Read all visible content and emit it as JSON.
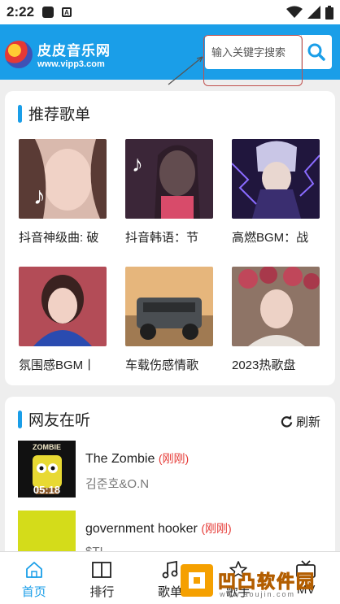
{
  "status_bar": {
    "time": "2:22"
  },
  "header": {
    "logo_name": "皮皮音乐网",
    "logo_url": "www.vipp3.com",
    "search_placeholder": "输入关键字搜索"
  },
  "recommended": {
    "title": "推荐歌单",
    "items": [
      {
        "caption": "抖音神级曲: 破",
        "thumb_color": "#d7b3a6"
      },
      {
        "caption": "抖音韩语：节",
        "thumb_color": "#3a2434"
      },
      {
        "caption": "高燃BGM：战",
        "thumb_color": "#251a46"
      },
      {
        "caption": "氛围感BGM丨",
        "thumb_color": "#b5505b"
      },
      {
        "caption": "车载伤感情歌",
        "thumb_color": "#c8a278"
      },
      {
        "caption": "2023热歌盘",
        "thumb_color": "#8c6e5e"
      }
    ]
  },
  "listening": {
    "title": "网友在听",
    "refresh_label": "刷新",
    "songs": [
      {
        "title": "The Zombie",
        "tag": "(刚刚)",
        "artist": "김준호&O.N",
        "duration": "05:18",
        "cover_caption": "ZOMBIE"
      },
      {
        "title": "government hooker",
        "tag": "(刚刚)",
        "artist": "$TI",
        "duration": "",
        "cover_caption": ""
      }
    ]
  },
  "tabbar": {
    "tabs": [
      {
        "label": "首页",
        "icon": "home-icon"
      },
      {
        "label": "排行",
        "icon": "book-icon"
      },
      {
        "label": "歌单",
        "icon": "music-note-icon"
      },
      {
        "label": "歌手",
        "icon": "star-icon"
      },
      {
        "label": "MV",
        "icon": "tv-icon"
      }
    ]
  },
  "watermark": {
    "text": "凹凸软件园",
    "url": "www.aoujin.com"
  },
  "colors": {
    "accent": "#1a9ee8",
    "tag": "#e53935",
    "watermark": "#f5a000"
  }
}
